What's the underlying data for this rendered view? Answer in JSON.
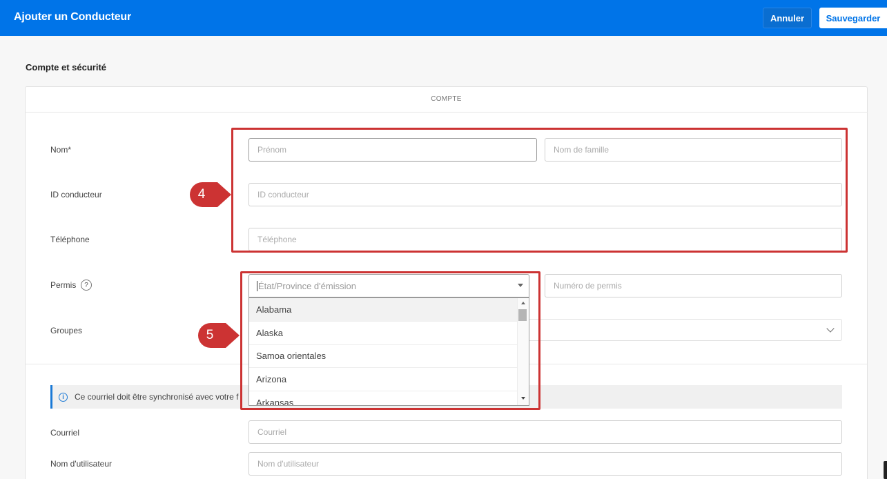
{
  "header": {
    "title": "Ajouter un Conducteur",
    "cancel_label": "Annuler",
    "save_label": "Sauvegarder"
  },
  "section": {
    "title": "Compte et sécurité",
    "card_header": "COMPTE"
  },
  "form": {
    "name_label": "Nom*",
    "first_name_placeholder": "Prénom",
    "last_name_placeholder": "Nom de famille",
    "driver_id_label": "ID conducteur",
    "driver_id_placeholder": "ID conducteur",
    "phone_label": "Téléphone",
    "phone_placeholder": "Téléphone",
    "license_label": "Permis",
    "license_help": "?",
    "state_placeholder": "État/Province d'émission",
    "license_number_placeholder": "Numéro de permis",
    "groups_label": "Groupes",
    "info_text": "Ce courriel doit être synchronisé avec votre f",
    "info_icon_glyph": "i",
    "email_label": "Courriel",
    "email_placeholder": "Courriel",
    "username_label": "Nom d'utilisateur",
    "username_placeholder": "Nom d'utilisateur"
  },
  "dropdown": {
    "options": [
      "Alabama",
      "Alaska",
      "Samoa orientales",
      "Arizona",
      "Arkansas"
    ],
    "highlighted": "Alabama"
  },
  "annotations": {
    "marker_4": "4",
    "marker_5": "5",
    "color": "#cc3333"
  },
  "colors": {
    "brand": "#0074e8",
    "info_accent": "#1a79d6"
  },
  "icons": [
    "help-icon",
    "caret-down-icon",
    "chevron-down-icon",
    "info-icon",
    "scroll-up-icon",
    "scroll-down-icon"
  ]
}
